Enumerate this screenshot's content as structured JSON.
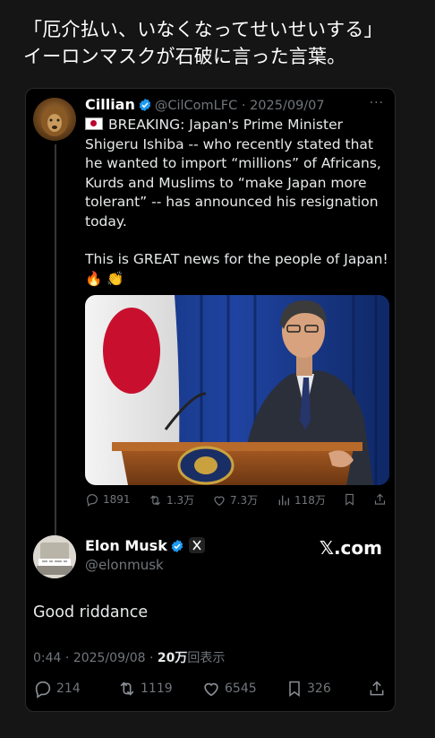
{
  "headline": {
    "line1": "「厄介払い、いなくなってせいせいする」",
    "line2": "イーロンマスクが石破に言った言葉。"
  },
  "quoted_post": {
    "author_name": "Cillian",
    "author_handle": "@CilComLFC",
    "date": "2025/09/07",
    "more_label": "···",
    "text_line1": "BREAKING: Japan's Prime Minister Shigeru Ishiba -- who recently stated that he wanted to import “millions” of Africans, Kurds and Muslims to “make Japan more tolerant” -- has announced his resignation today.",
    "text_line2": "This is GREAT news for the people of Japan!",
    "emojis": "🔥 👏",
    "stats": {
      "replies": "1891",
      "reposts": "1.3万",
      "likes": "7.3万",
      "views": "118万"
    }
  },
  "main_post": {
    "author_name": "Elon Musk",
    "author_handle": "@elonmusk",
    "brand": "𝕏.com",
    "text": "Good riddance",
    "time": "0:44",
    "date": "2025/09/08",
    "views_count": "20万",
    "views_label": "回表示",
    "stats": {
      "replies": "214",
      "reposts": "1119",
      "likes": "6545",
      "bookmarks": "326"
    }
  },
  "colors": {
    "background": "#151515",
    "card": "#000000",
    "muted": "#71767b",
    "verified": "#1d9bf0"
  },
  "icons": [
    "verified-badge-icon",
    "more-icon",
    "reply-icon",
    "repost-icon",
    "like-icon",
    "views-icon",
    "bookmark-icon",
    "share-icon"
  ]
}
